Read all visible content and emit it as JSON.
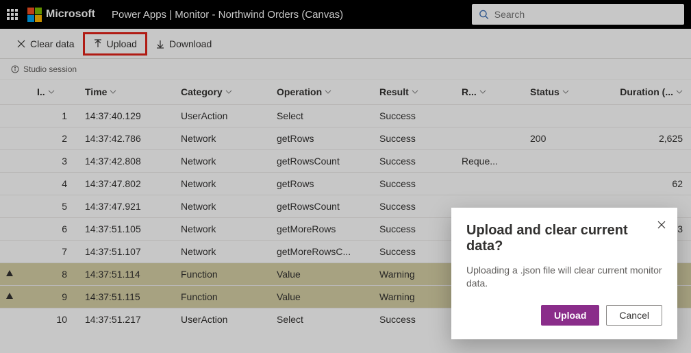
{
  "header": {
    "brand": "Microsoft",
    "app_title": "Power Apps  |  Monitor - Northwind Orders (Canvas)",
    "search_placeholder": "Search"
  },
  "toolbar": {
    "clear_label": "Clear data",
    "upload_label": "Upload",
    "download_label": "Download"
  },
  "session_label": "Studio session",
  "columns": {
    "icon": "",
    "index": "I..",
    "time": "Time",
    "category": "Category",
    "operation": "Operation",
    "result": "Result",
    "r": "R...",
    "status": "Status",
    "duration": "Duration (..."
  },
  "rows": [
    {
      "warn": false,
      "idx": "1",
      "time": "14:37:40.129",
      "category": "UserAction",
      "operation": "Select",
      "result": "Success",
      "r": "",
      "status": "",
      "duration": ""
    },
    {
      "warn": false,
      "idx": "2",
      "time": "14:37:42.786",
      "category": "Network",
      "operation": "getRows",
      "result": "Success",
      "r": "",
      "status": "200",
      "duration": "2,625"
    },
    {
      "warn": false,
      "idx": "3",
      "time": "14:37:42.808",
      "category": "Network",
      "operation": "getRowsCount",
      "result": "Success",
      "r": "Reque...",
      "status": "",
      "duration": ""
    },
    {
      "warn": false,
      "idx": "4",
      "time": "14:37:47.802",
      "category": "Network",
      "operation": "getRows",
      "result": "Success",
      "r": "",
      "status": "",
      "duration": "62"
    },
    {
      "warn": false,
      "idx": "5",
      "time": "14:37:47.921",
      "category": "Network",
      "operation": "getRowsCount",
      "result": "Success",
      "r": "",
      "status": "",
      "duration": ""
    },
    {
      "warn": false,
      "idx": "6",
      "time": "14:37:51.105",
      "category": "Network",
      "operation": "getMoreRows",
      "result": "Success",
      "r": "",
      "status": "",
      "duration": "93"
    },
    {
      "warn": false,
      "idx": "7",
      "time": "14:37:51.107",
      "category": "Network",
      "operation": "getMoreRowsC...",
      "result": "Success",
      "r": "",
      "status": "",
      "duration": ""
    },
    {
      "warn": true,
      "idx": "8",
      "time": "14:37:51.114",
      "category": "Function",
      "operation": "Value",
      "result": "Warning",
      "r": "",
      "status": "",
      "duration": ""
    },
    {
      "warn": true,
      "idx": "9",
      "time": "14:37:51.115",
      "category": "Function",
      "operation": "Value",
      "result": "Warning",
      "r": "",
      "status": "",
      "duration": ""
    },
    {
      "warn": false,
      "idx": "10",
      "time": "14:37:51.217",
      "category": "UserAction",
      "operation": "Select",
      "result": "Success",
      "r": "",
      "status": "",
      "duration": ""
    }
  ],
  "dialog": {
    "title": "Upload and clear current data?",
    "body": "Uploading a .json file will clear current monitor data.",
    "primary": "Upload",
    "secondary": "Cancel"
  }
}
